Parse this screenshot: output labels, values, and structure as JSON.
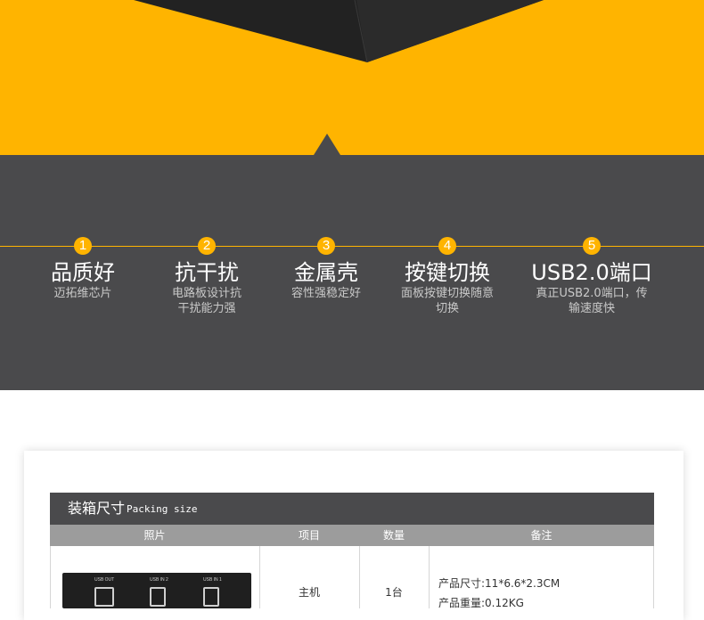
{
  "colors": {
    "accent": "#ffb400",
    "dark": "#4a4a4c",
    "table_header": "#9c9c9c"
  },
  "features": [
    {
      "num": "1",
      "title": "品质好",
      "desc": "迈拓维芯片"
    },
    {
      "num": "2",
      "title": "抗干扰",
      "desc": "电路板设计抗干扰能力强"
    },
    {
      "num": "3",
      "title": "金属壳",
      "desc": "容性强稳定好"
    },
    {
      "num": "4",
      "title": "按键切换",
      "desc": "面板按键切换随意切换"
    },
    {
      "num": "5",
      "title": "USB2.0端口",
      "desc": "真正USB2.0端口，传输速度快"
    }
  ],
  "packing": {
    "title_zh": "装箱尺寸",
    "title_en": "Packing size",
    "columns": [
      "照片",
      "项目",
      "数量",
      "备注"
    ],
    "row": {
      "item": "主机",
      "qty": "1台",
      "note_line1": "产品尺寸:11*6.6*2.3CM",
      "note_line2": "产品重量:0.12KG"
    },
    "device_ports": [
      "USB OUT",
      "USB IN 2",
      "USB IN 1"
    ]
  }
}
